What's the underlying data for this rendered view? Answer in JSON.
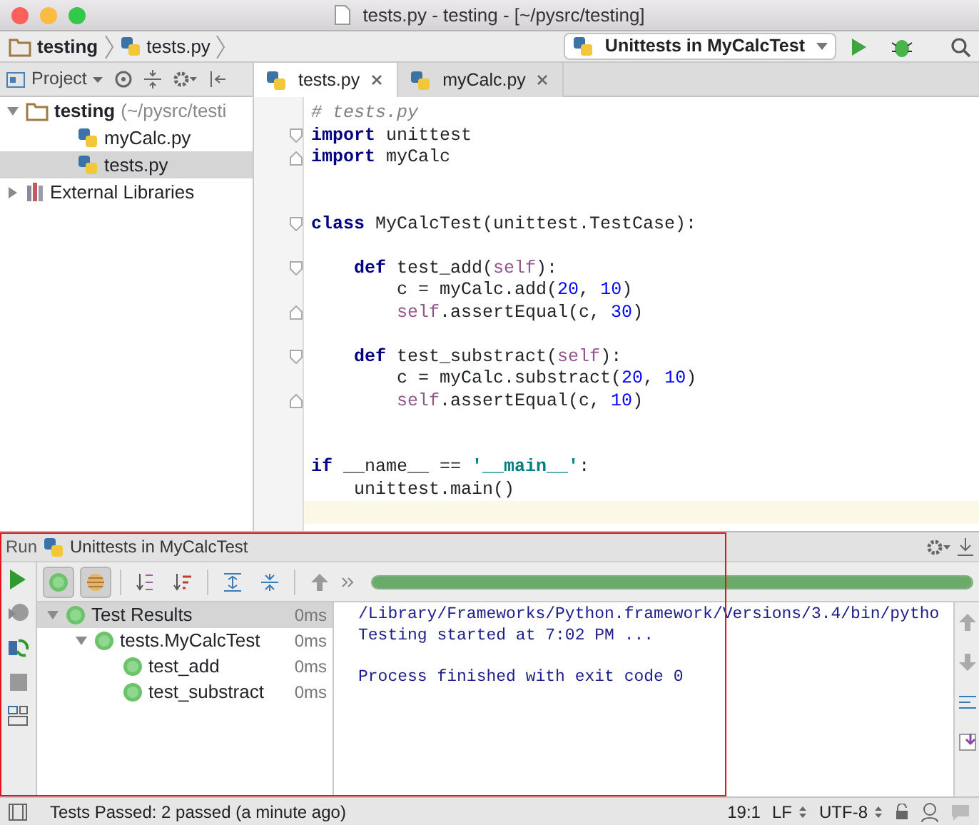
{
  "window": {
    "title": "tests.py - testing - [~/pysrc/testing]"
  },
  "breadcrumbs": [
    {
      "label": "testing",
      "kind": "folder"
    },
    {
      "label": "tests.py",
      "kind": "pyfile"
    }
  ],
  "run_config": {
    "label": "Unittests in MyCalcTest"
  },
  "project_panel": {
    "title": "Project",
    "tree": [
      {
        "label": "testing",
        "note": "(~/pysrc/testi",
        "kind": "folder",
        "expanded": true,
        "selected": false,
        "children": [
          {
            "label": "myCalc.py",
            "kind": "pyfile",
            "selected": false
          },
          {
            "label": "tests.py",
            "kind": "pyfile",
            "selected": true
          }
        ]
      },
      {
        "label": "External Libraries",
        "kind": "library",
        "expanded": false,
        "selected": false
      }
    ]
  },
  "tabs": [
    {
      "label": "tests.py",
      "selected": true
    },
    {
      "label": "myCalc.py",
      "selected": false
    }
  ],
  "code": [
    {
      "kind": "plain",
      "tokens": [
        {
          "comment": "# tests.py"
        }
      ]
    },
    {
      "kind": "foldstart",
      "tokens": [
        {
          "keyword": "import"
        },
        {
          "text": " unittest"
        }
      ]
    },
    {
      "kind": "foldend",
      "tokens": [
        {
          "keyword": "import"
        },
        {
          "text": " myCalc"
        }
      ]
    },
    {
      "kind": "blank"
    },
    {
      "kind": "blank"
    },
    {
      "kind": "foldstart",
      "tokens": [
        {
          "keyword": "class"
        },
        {
          "text": " MyCalcTest(unittest.TestCase):"
        }
      ]
    },
    {
      "kind": "blank"
    },
    {
      "kind": "foldstart",
      "tokens": [
        {
          "keyword": "    def"
        },
        {
          "text": " test_add("
        },
        {
          "self": "self"
        },
        {
          "text": "):"
        }
      ]
    },
    {
      "kind": "plain",
      "tokens": [
        {
          "text": "        c = myCalc.add("
        },
        {
          "number": "20"
        },
        {
          "text": ", "
        },
        {
          "number": "10"
        },
        {
          "text": ")"
        }
      ]
    },
    {
      "kind": "foldend",
      "tokens": [
        {
          "self": "        self"
        },
        {
          "text": ".assertEqual(c, "
        },
        {
          "number": "30"
        },
        {
          "text": ")"
        }
      ]
    },
    {
      "kind": "blank"
    },
    {
      "kind": "foldstart",
      "tokens": [
        {
          "keyword": "    def"
        },
        {
          "text": " test_substract("
        },
        {
          "self": "self"
        },
        {
          "text": "):"
        }
      ]
    },
    {
      "kind": "plain",
      "tokens": [
        {
          "text": "        c = myCalc.substract("
        },
        {
          "number": "20"
        },
        {
          "text": ", "
        },
        {
          "number": "10"
        },
        {
          "text": ")"
        }
      ]
    },
    {
      "kind": "foldend",
      "tokens": [
        {
          "self": "        self"
        },
        {
          "text": ".assertEqual(c, "
        },
        {
          "number": "10"
        },
        {
          "text": ")"
        }
      ]
    },
    {
      "kind": "blank"
    },
    {
      "kind": "blank"
    },
    {
      "kind": "plain",
      "tokens": [
        {
          "keyword": "if"
        },
        {
          "text": " __name__ == "
        },
        {
          "string": "'__main__'"
        },
        {
          "text": ":"
        }
      ]
    },
    {
      "kind": "plain",
      "tokens": [
        {
          "text": "    unittest.main()"
        }
      ]
    },
    {
      "kind": "cursor"
    }
  ],
  "run_panel": {
    "label": "Run",
    "config": "Unittests in MyCalcTest",
    "toolbar": [
      {
        "kind": "show-passed",
        "pressed": true
      },
      {
        "kind": "show-ignored",
        "pressed": true
      },
      {
        "kind": "sort-alpha",
        "pressed": false
      },
      {
        "kind": "sort-duration",
        "pressed": false
      },
      {
        "kind": "expand-all",
        "pressed": false
      },
      {
        "kind": "collapse-all",
        "pressed": false
      },
      {
        "kind": "previous",
        "pressed": false
      }
    ],
    "progress": {
      "level": 1
    },
    "results": [
      {
        "label": "Test Results",
        "time": "0ms",
        "selected": true,
        "expanded": true,
        "children": [
          {
            "label": "tests.MyCalcTest",
            "time": "0ms",
            "selected": false,
            "expanded": true,
            "children": [
              {
                "label": "test_add",
                "time": "0ms",
                "selected": false
              },
              {
                "label": "test_substract",
                "time": "0ms",
                "selected": false
              }
            ]
          }
        ]
      }
    ],
    "console": [
      [
        "/Library/Frameworks/Python.framework/Versions/3.4/bin/pytho",
        "Testing started at 7:02 PM ..."
      ],
      [
        "Process finished with exit code 0"
      ]
    ]
  },
  "status_bar": {
    "message": "Tests Passed: 2 passed (a minute ago)",
    "position": "19:1",
    "line_separator": "LF",
    "encoding": "UTF-8"
  }
}
